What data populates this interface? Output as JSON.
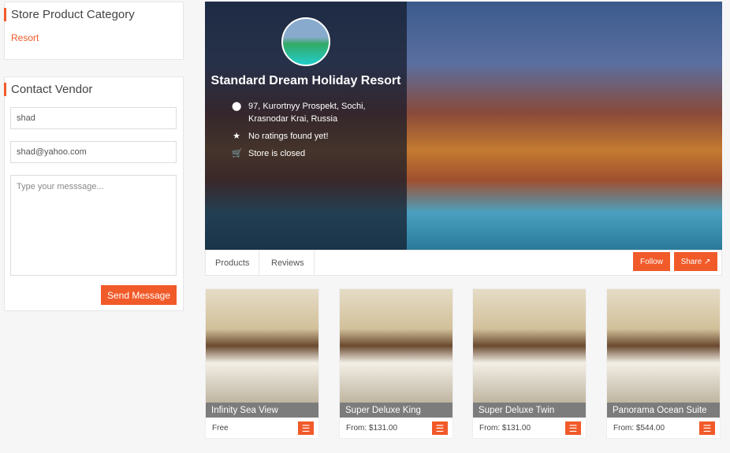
{
  "sidebar": {
    "category_title": "Store Product Category",
    "category_link": "Resort",
    "contact_title": "Contact Vendor",
    "name_value": "shad",
    "email_value": "shad@yahoo.com",
    "message_placeholder": "Type your messsage...",
    "send_label": "Send Message"
  },
  "store": {
    "name": "Standard Dream Holiday Resort",
    "address": "97, Kurortnyy Prospekt, Sochi, Krasnodar Krai, Russia",
    "rating": "No ratings found yet!",
    "status": "Store is closed"
  },
  "tabs": [
    {
      "label": "Products"
    },
    {
      "label": "Reviews"
    }
  ],
  "actions": {
    "follow": "Follow",
    "share": "Share"
  },
  "accent": "#f15a29",
  "products": [
    {
      "title": "Infinity Sea View",
      "price": "Free"
    },
    {
      "title": "Super Deluxe King",
      "price": "From: $131.00"
    },
    {
      "title": "Super Deluxe Twin",
      "price": "From: $131.00"
    },
    {
      "title": "Panorama Ocean Suite",
      "price": "From: $544.00"
    }
  ]
}
